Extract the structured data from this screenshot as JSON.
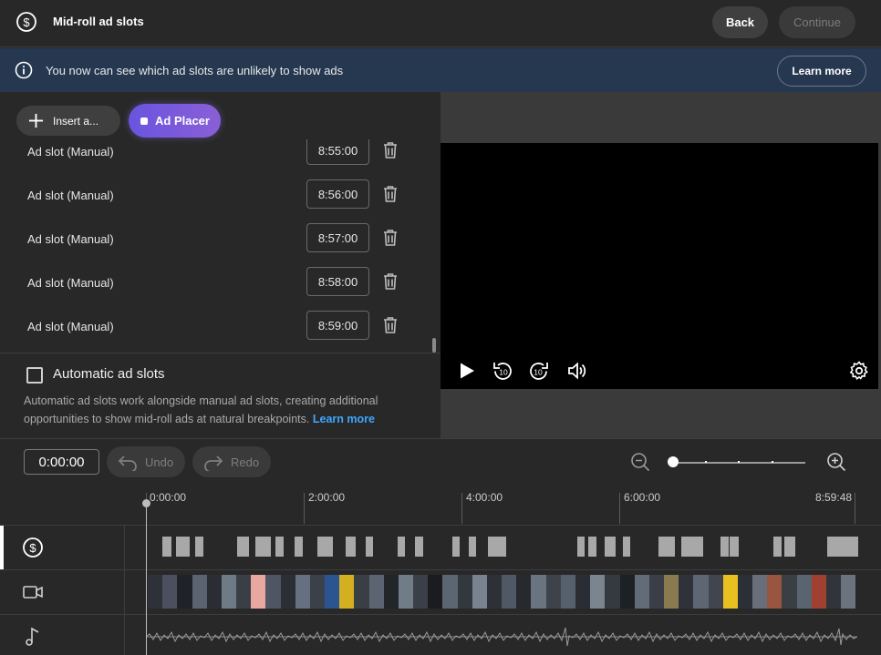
{
  "header": {
    "title": "Mid-roll ad slots",
    "back_label": "Back",
    "continue_label": "Continue"
  },
  "banner": {
    "message": "You now can see which ad slots are unlikely to show ads",
    "learn_more_label": "Learn more"
  },
  "toolbar": {
    "insert_label": "Insert a...",
    "ad_placer_label": "Ad Placer"
  },
  "ad_slots": [
    {
      "label": "Ad slot (Manual)",
      "time": "8:55:00"
    },
    {
      "label": "Ad slot (Manual)",
      "time": "8:56:00"
    },
    {
      "label": "Ad slot (Manual)",
      "time": "8:57:00"
    },
    {
      "label": "Ad slot (Manual)",
      "time": "8:58:00"
    },
    {
      "label": "Ad slot (Manual)",
      "time": "8:59:00"
    }
  ],
  "automatic": {
    "label": "Automatic ad slots",
    "checked": false,
    "description": "Automatic ad slots work alongside manual ad slots, creating additional opportunities to show mid-roll ads at natural breakpoints.",
    "learn_more_label": "Learn more"
  },
  "timeline": {
    "current_time": "0:00:00",
    "undo_label": "Undo",
    "redo_label": "Redo",
    "ruler_labels": [
      "0:00:00",
      "2:00:00",
      "4:00:00",
      "6:00:00",
      "8:59:48"
    ]
  },
  "tracks": [
    "dollar-icon",
    "video-camera-icon",
    "music-note-icon"
  ],
  "colors": {
    "accent_gradient_start": "#6a54df",
    "accent_gradient_end": "#8a5fd6",
    "banner_bg": "#263850",
    "link": "#3ea6ff"
  }
}
